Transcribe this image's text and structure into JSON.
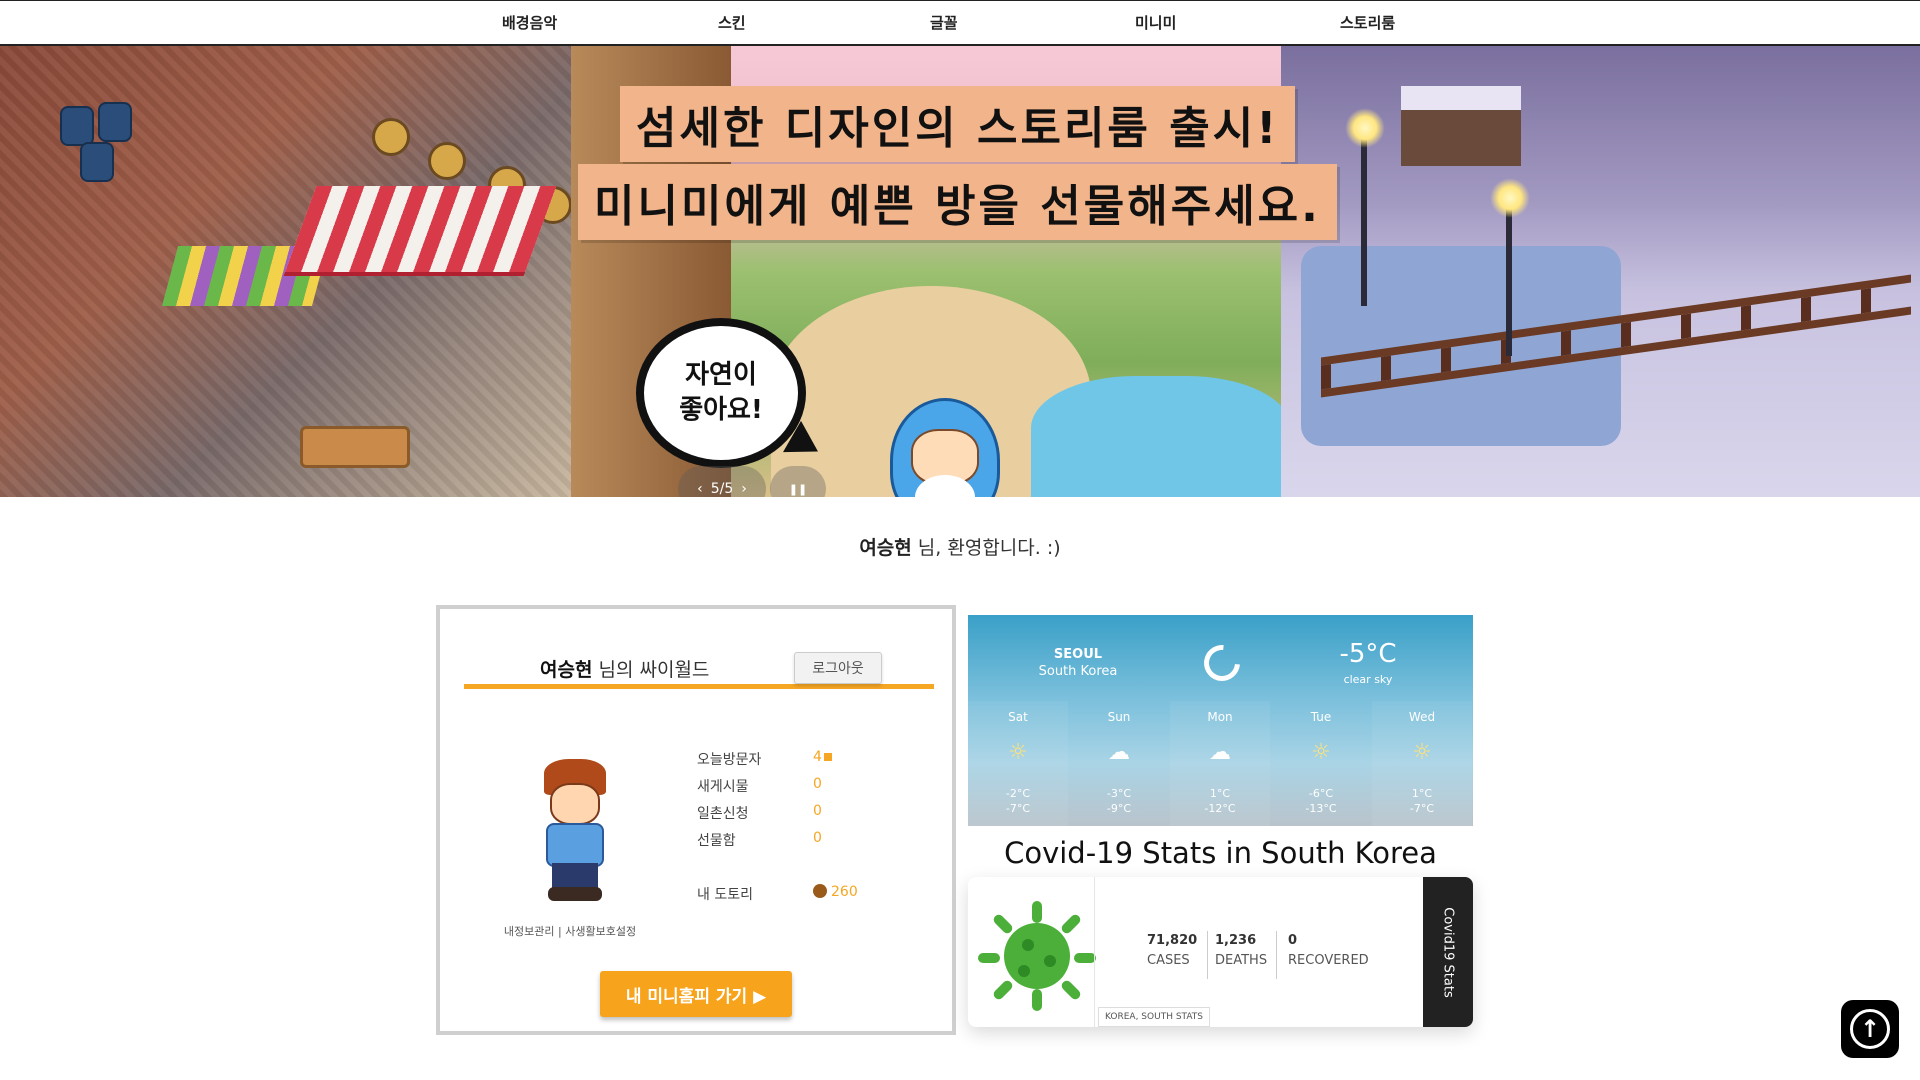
{
  "nav": {
    "items": [
      "배경음악",
      "스킨",
      "글꼴",
      "미니미",
      "스토리룸"
    ]
  },
  "banner": {
    "caption_line1": "섬세한 디자인의 스토리룸 출시!",
    "caption_line2": "미니미에게 예쁜 방을 선물해주세요.",
    "bubble_line1": "자연이",
    "bubble_line2": "좋아요!",
    "slide_indicator": "5/5",
    "prev_icon": "‹",
    "next_icon": "›",
    "pause_icon": "❚❚"
  },
  "welcome": {
    "name": "여승현",
    "suffix": " 님, 환영합니다. :)"
  },
  "profile": {
    "name": "여승현",
    "title_suffix": " 님의 싸이월드",
    "logout_label": "로그아웃",
    "stats": [
      {
        "label": "오늘방문자",
        "value": "4"
      },
      {
        "label": "새게시물",
        "value": "0"
      },
      {
        "label": "일촌신청",
        "value": "0"
      },
      {
        "label": "선물함",
        "value": "0"
      }
    ],
    "acorn_label": "내 도토리",
    "acorn_value": "260",
    "privacy_text": "내정보관리 | 사생활보호설정",
    "minihome_button": "내 미니홈피 가기 ▶"
  },
  "weather": {
    "city": "SEOUL",
    "country": "South Korea",
    "current_temp": "-5°C",
    "current_desc": "clear sky",
    "current_icon": "moon-icon",
    "forecast": [
      {
        "day": "Sat",
        "icon": "sun-icon",
        "glyph": "☼",
        "hi": "-2°C",
        "lo": "-7°C"
      },
      {
        "day": "Sun",
        "icon": "cloud-icon",
        "glyph": "☁",
        "hi": "-3°C",
        "lo": "-9°C"
      },
      {
        "day": "Mon",
        "icon": "cloud-icon",
        "glyph": "☁",
        "hi": "1°C",
        "lo": "-12°C"
      },
      {
        "day": "Tue",
        "icon": "sun-icon",
        "glyph": "☼",
        "hi": "-6°C",
        "lo": "-13°C"
      },
      {
        "day": "Wed",
        "icon": "sun-icon",
        "glyph": "☼",
        "hi": "1°C",
        "lo": "-7°C"
      }
    ]
  },
  "covid": {
    "title": "Covid-19 Stats in South Korea",
    "cases_value": "71,820",
    "cases_label": "CASES",
    "deaths_value": "1,236",
    "deaths_label": "DEATHS",
    "recovered_value": "0",
    "recovered_label": "RECOVERED",
    "tag": "KOREA, SOUTH STATS",
    "side_label": "Covid19 Stats"
  },
  "colors": {
    "accent": "#f5a623",
    "button": "#f7a31c",
    "virus": "#4caf3a"
  },
  "icons": {
    "to_top": "arrow-up-icon"
  }
}
